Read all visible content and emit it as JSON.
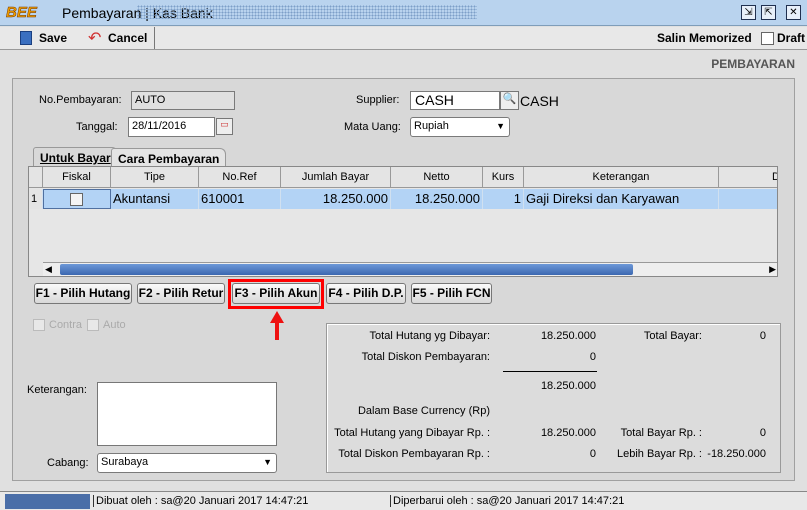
{
  "window": {
    "logo": "BEE",
    "title": "Pembayaran | Kas Bank"
  },
  "toolbar": {
    "save": "Save",
    "cancel": "Cancel",
    "salin": "Salin Memorized",
    "draft": "Draft"
  },
  "page_header": "PEMBAYARAN",
  "form": {
    "no_label": "No.Pembayaran:",
    "no_value": "AUTO",
    "tanggal_label": "Tanggal:",
    "tanggal_value": "28/11/2016",
    "supplier_label": "Supplier:",
    "supplier_value": "CASH",
    "supplier_name": "CASH",
    "mata_uang_label": "Mata Uang:",
    "mata_uang_value": "Rupiah"
  },
  "tabs": [
    "Untuk Bayar",
    "Cara Pembayaran"
  ],
  "grid": {
    "columns": [
      "Fiskal",
      "Tipe",
      "No.Ref",
      "Jumlah Bayar",
      "Netto",
      "Kurs",
      "Keterangan",
      "De"
    ],
    "rows": [
      {
        "num": "1",
        "fiskal": false,
        "tipe": "Akuntansi",
        "noref": "610001",
        "jumlah": "18.250.000",
        "netto": "18.250.000",
        "kurs": "1",
        "keterangan": "Gaji Direksi dan Karyawan"
      }
    ]
  },
  "buttons": [
    "F1 - Pilih Hutang",
    "F2 - Pilih Retur",
    "F3 - Pilih Akun",
    "F4 - Pilih D.P.",
    "F5 - Pilih FCN"
  ],
  "options": {
    "contra": "Contra",
    "auto": "Auto"
  },
  "keterangan_label": "Keterangan:",
  "cabang": {
    "label": "Cabang:",
    "value": "Surabaya"
  },
  "summary": {
    "total_hutang_label": "Total Hutang yg Dibayar:",
    "total_hutang": "18.250.000",
    "total_diskon_label": "Total Diskon Pembayaran:",
    "total_diskon": "0",
    "subtotal": "18.250.000",
    "total_bayar_label": "Total Bayar:",
    "total_bayar": "0",
    "base_label": "Dalam Base Currency (Rp)",
    "hutang_rp_label": "Total Hutang yang Dibayar Rp. :",
    "hutang_rp": "18.250.000",
    "diskon_rp_label": "Total Diskon Pembayaran Rp. :",
    "diskon_rp": "0",
    "bayar_rp_label": "Total Bayar Rp. :",
    "bayar_rp": "0",
    "lebih_label": "Lebih Bayar Rp. :",
    "lebih": "-18.250.000"
  },
  "status": {
    "created": "Dibuat oleh : sa@20 Januari 2017  14:47:21",
    "updated": "Diperbarui oleh : sa@20 Januari 2017  14:47:21"
  },
  "colors": {
    "highlight": "#ff0000",
    "selected_row": "#b3d3f5",
    "titlebar": "#b9d3ee"
  }
}
